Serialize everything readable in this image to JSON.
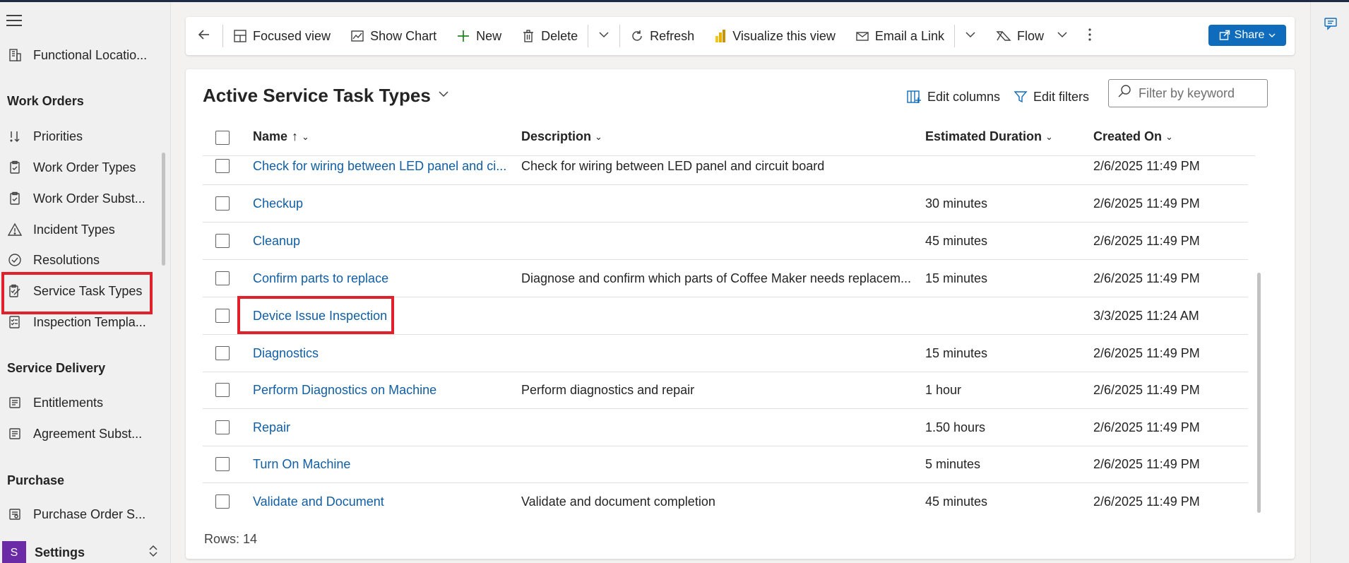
{
  "sidebar": {
    "items_top": [
      {
        "label": "Functional Locatio...",
        "icon": "building-icon"
      }
    ],
    "groups": [
      {
        "title": "Work Orders",
        "items": [
          {
            "label": "Priorities",
            "icon": "priority-icon"
          },
          {
            "label": "Work Order Types",
            "icon": "clipboard-icon"
          },
          {
            "label": "Work Order Subst...",
            "icon": "clipboard-icon"
          },
          {
            "label": "Incident Types",
            "icon": "warning-icon"
          },
          {
            "label": "Resolutions",
            "icon": "check-circle-icon"
          },
          {
            "label": "Service Task Types",
            "icon": "task-edit-icon"
          },
          {
            "label": "Inspection Templa...",
            "icon": "checklist-icon"
          }
        ]
      },
      {
        "title": "Service Delivery",
        "items": [
          {
            "label": "Entitlements",
            "icon": "document-icon"
          },
          {
            "label": "Agreement Subst...",
            "icon": "document-icon"
          }
        ]
      },
      {
        "title": "Purchase",
        "items": [
          {
            "label": "Purchase Order S...",
            "icon": "document-icon"
          }
        ]
      }
    ],
    "settings": {
      "badge": "S",
      "label": "Settings"
    }
  },
  "toolbar": {
    "focused_view": "Focused view",
    "show_chart": "Show Chart",
    "new": "New",
    "delete": "Delete",
    "refresh": "Refresh",
    "visualize": "Visualize this view",
    "email_link": "Email a Link",
    "flow": "Flow",
    "share": "Share"
  },
  "view": {
    "title": "Active Service Task Types",
    "edit_columns": "Edit columns",
    "edit_filters": "Edit filters",
    "filter_placeholder": "Filter by keyword",
    "rows_label": "Rows: 14"
  },
  "grid": {
    "columns": [
      "Name",
      "Description",
      "Estimated Duration",
      "Created On"
    ],
    "name_sort_glyph": "↑",
    "rows": [
      {
        "name": "Check for wiring between LED panel and ci...",
        "description": "Check for wiring between LED panel and circuit board",
        "duration": "",
        "created": "2/6/2025 11:49 PM"
      },
      {
        "name": "Checkup",
        "description": "",
        "duration": "30 minutes",
        "created": "2/6/2025 11:49 PM"
      },
      {
        "name": "Cleanup",
        "description": "",
        "duration": "45 minutes",
        "created": "2/6/2025 11:49 PM"
      },
      {
        "name": "Confirm parts to replace",
        "description": "Diagnose and confirm which parts of Coffee Maker needs replacem...",
        "duration": "15 minutes",
        "created": "2/6/2025 11:49 PM"
      },
      {
        "name": "Device Issue Inspection",
        "description": "",
        "duration": "",
        "created": "3/3/2025 11:24 AM"
      },
      {
        "name": "Diagnostics",
        "description": "",
        "duration": "15 minutes",
        "created": "2/6/2025 11:49 PM"
      },
      {
        "name": "Perform Diagnostics on Machine",
        "description": "Perform diagnostics and repair",
        "duration": "1 hour",
        "created": "2/6/2025 11:49 PM"
      },
      {
        "name": "Repair",
        "description": "",
        "duration": "1.50 hours",
        "created": "2/6/2025 11:49 PM"
      },
      {
        "name": "Turn On Machine",
        "description": "",
        "duration": "5 minutes",
        "created": "2/6/2025 11:49 PM"
      },
      {
        "name": "Validate and Document",
        "description": "Validate and document completion",
        "duration": "45 minutes",
        "created": "2/6/2025 11:49 PM"
      }
    ]
  },
  "colors": {
    "link": "#115ea3",
    "accent": "#0f6cbd",
    "highlight": "#e0202a",
    "settings_badge": "#6b2aa6"
  }
}
